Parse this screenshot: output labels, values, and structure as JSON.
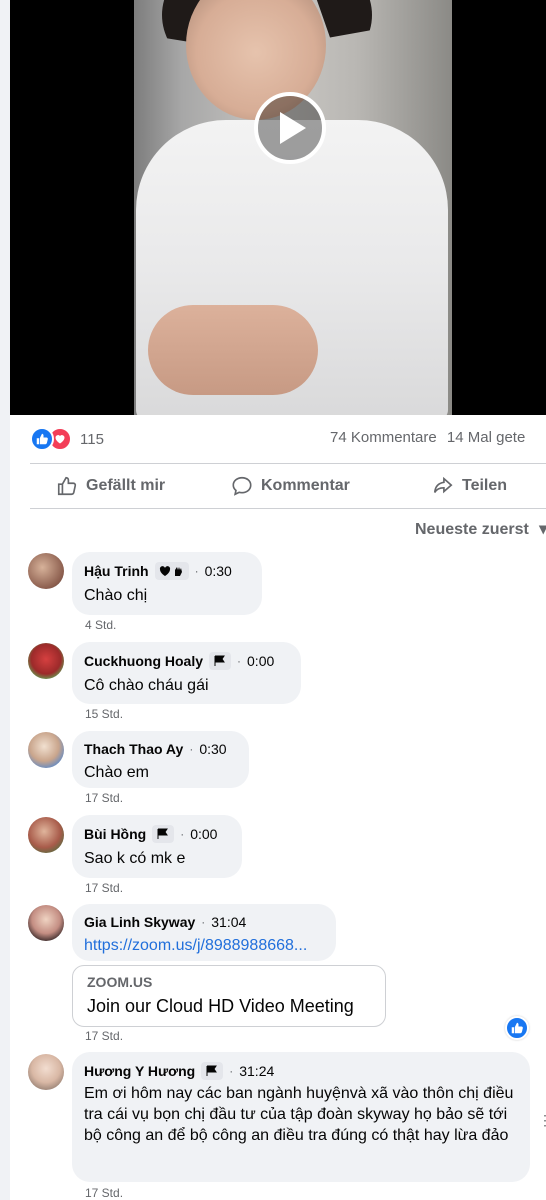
{
  "video": {
    "play_icon": "play-icon"
  },
  "stats": {
    "reaction_count": "115",
    "comments": "74 Kommentare",
    "views": "14 Mal gete",
    "reaction_icons": [
      "like-icon",
      "love-icon"
    ]
  },
  "actions": {
    "like": "Gefällt mir",
    "comment": "Kommentar",
    "share": "Teilen"
  },
  "sort_label": "Neueste zuerst",
  "comments": [
    {
      "name": "Hậu Trinh",
      "badge": "heart-hand-badge",
      "time": "0:30",
      "text": "Chào chị",
      "age": "4 Std."
    },
    {
      "name": "Cuckhuong Hoaly",
      "badge": "flag-badge",
      "time": "0:00",
      "text": "Cô chào cháu gái",
      "age": "15 Std."
    },
    {
      "name": "Thach Thao Ay",
      "badge": "",
      "time": "0:30",
      "text": "Chào em",
      "age": "17 Std."
    },
    {
      "name": "Bùi Hồng",
      "badge": "flag-badge",
      "time": "0:00",
      "text": "Sao k có mk e",
      "age": "17 Std."
    },
    {
      "name": "Gia Linh Skyway",
      "badge": "",
      "time": "31:04",
      "text": "https://zoom.us/j/8988988668...",
      "age": "17 Std.",
      "card": {
        "domain": "ZOOM.US",
        "title": "Join our Cloud HD Video Meeting"
      }
    },
    {
      "name": "Hương Y Hương",
      "badge": "flag-badge",
      "time": "31:24",
      "text": "Em ơi hôm nay các ban ngành huyệnvà xã vào thôn chị điều tra cái vụ bọn chị đầu tư của tập đoàn skyway họ bảo sẽ tới bộ công an để bộ công an điều tra đúng có thật hay lừa đảo",
      "age": "17 Std."
    }
  ],
  "colors": {
    "accent": "#1877f2",
    "love": "#f33e58",
    "bubble": "#f0f2f5",
    "muted": "#65676b",
    "link": "#216fdb"
  }
}
